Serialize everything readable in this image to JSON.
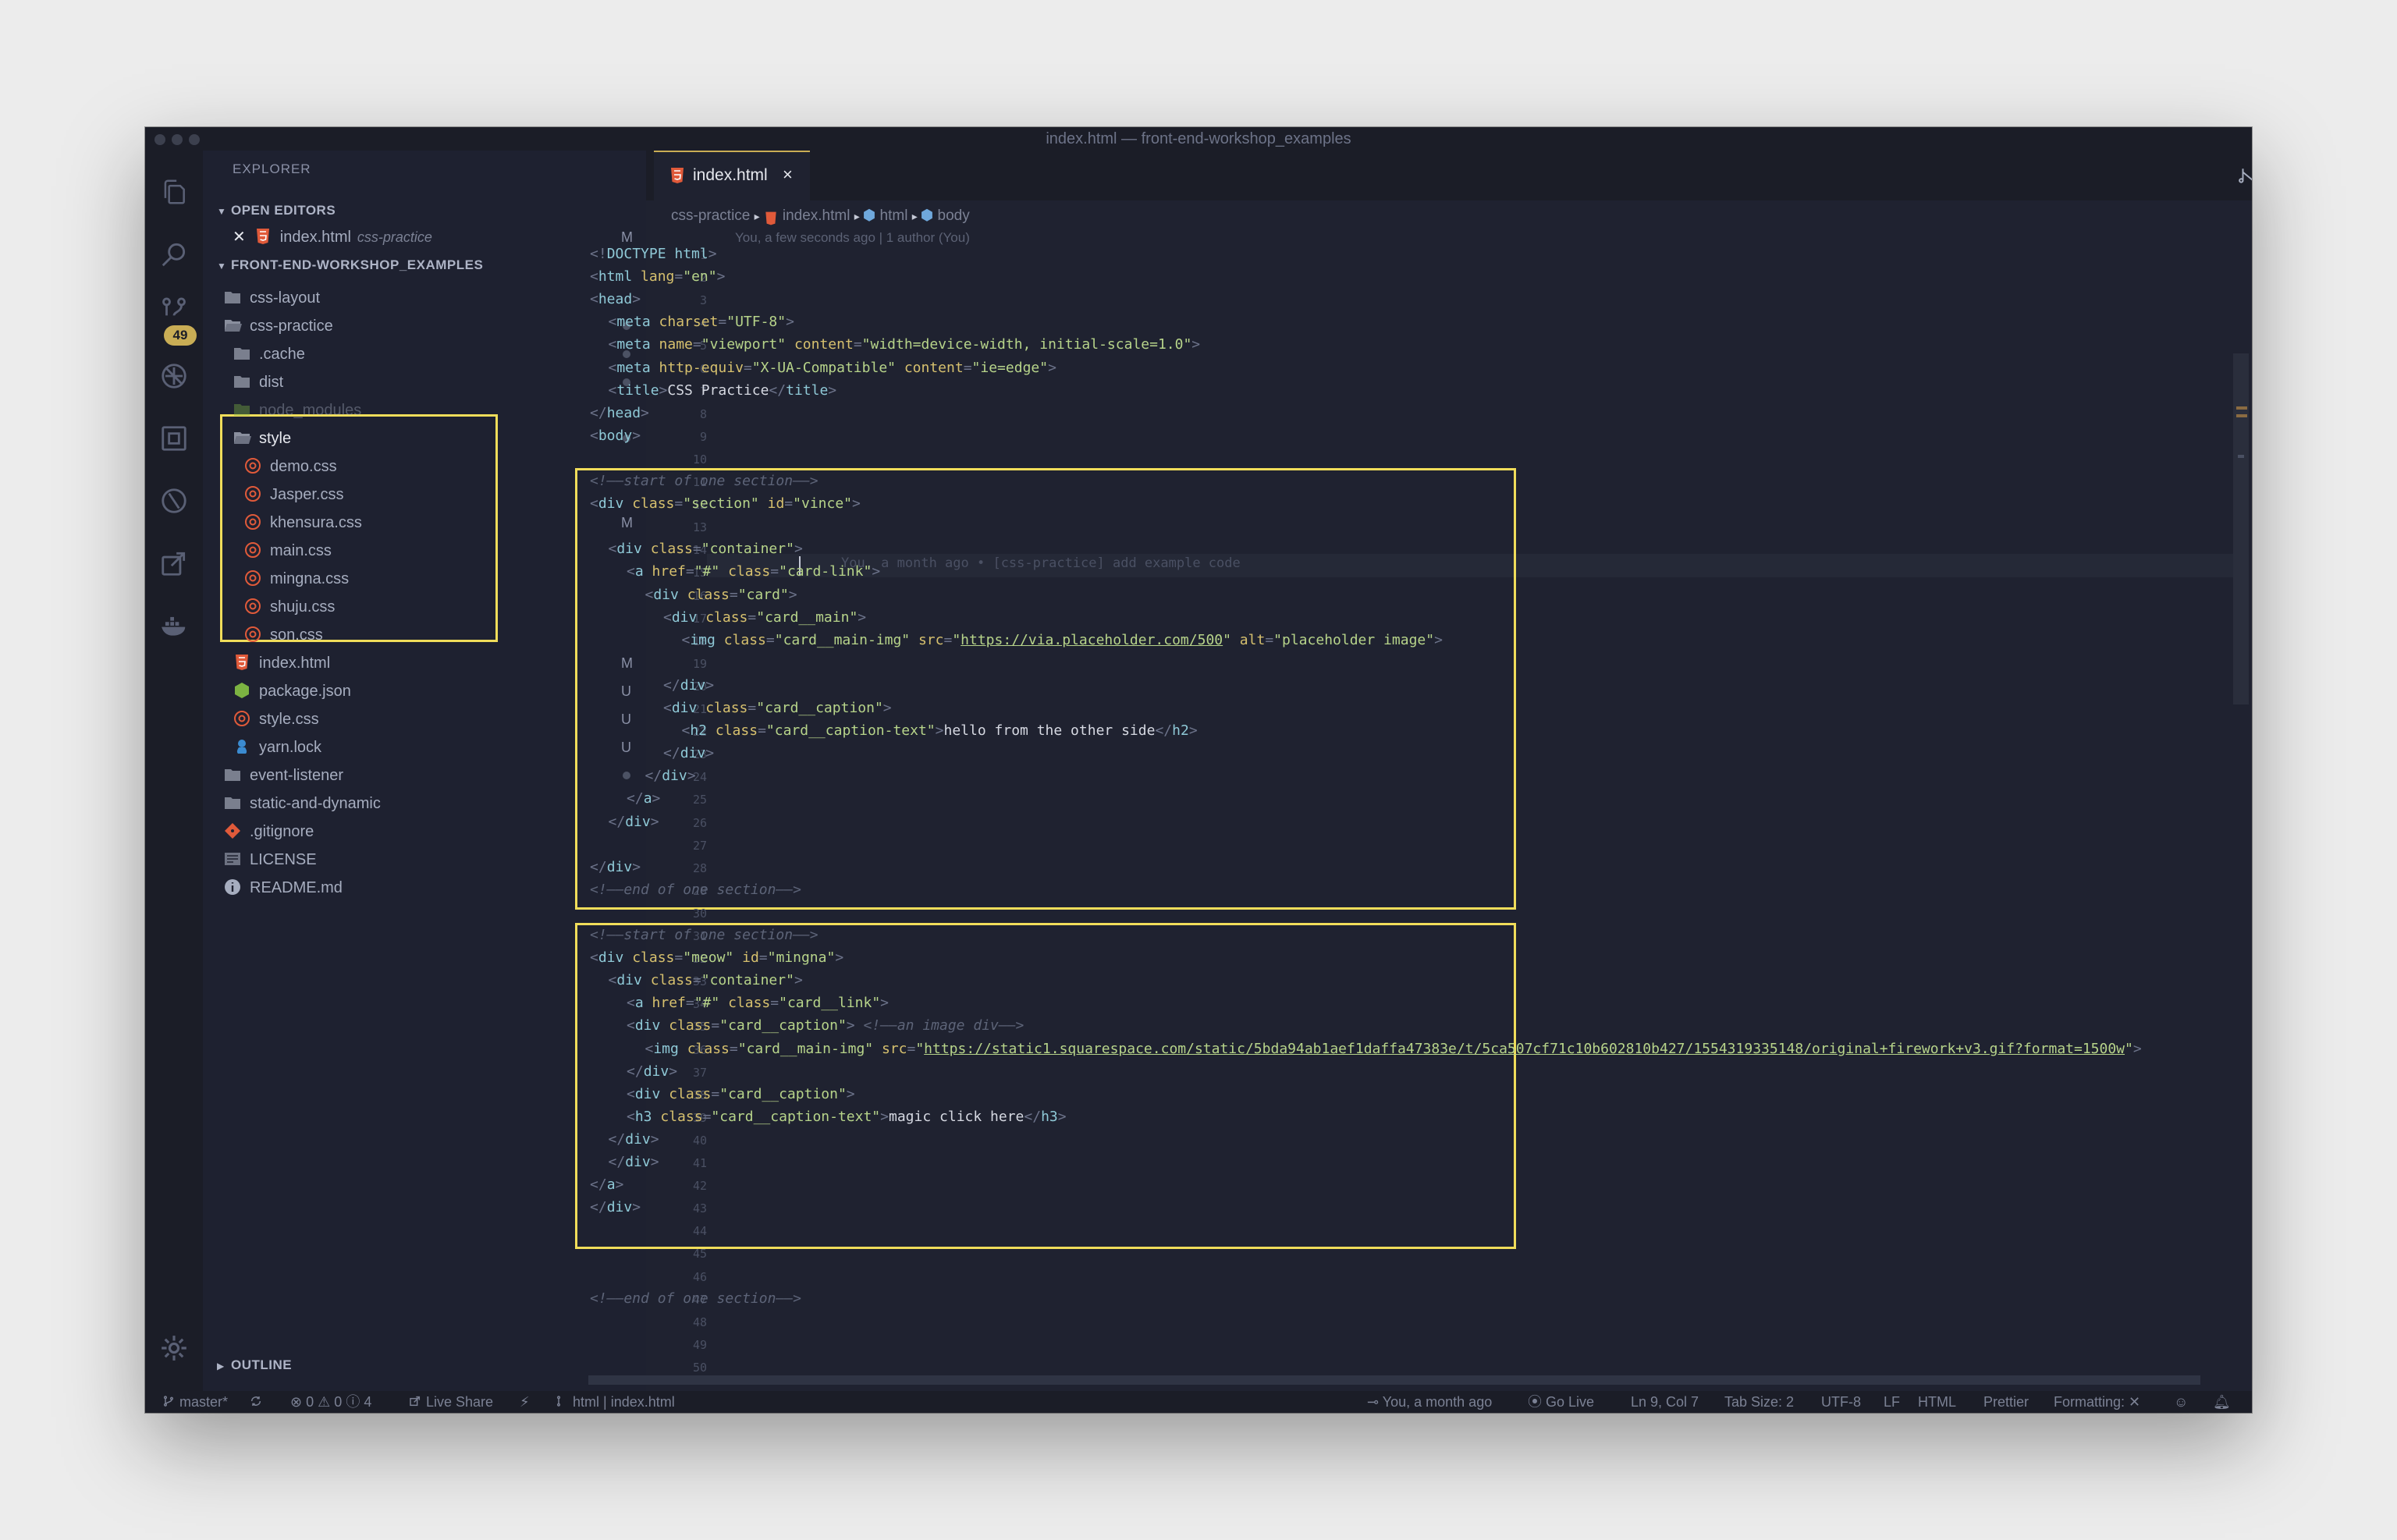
{
  "window": {
    "title": "index.html — front-end-workshop_examples"
  },
  "activity_bar": {
    "icons": [
      "files-icon",
      "search-icon",
      "source-control-icon",
      "debug-icon",
      "extensions-icon",
      "timeline-icon",
      "live-share-icon",
      "docker-icon",
      "settings-gear-icon"
    ],
    "scm_badge": "49"
  },
  "sidebar": {
    "title": "EXPLORER",
    "open_editors_label": "OPEN EDITORS",
    "open_editor": {
      "name": "index.html",
      "folder": "css-practice",
      "status": "M"
    },
    "workspace_label": "FRONT-END-WORKSHOP_EXAMPLES",
    "tree": [
      {
        "name": "css-layout",
        "kind": "folder",
        "status": ""
      },
      {
        "name": "css-practice",
        "kind": "folder-open",
        "status": ""
      },
      {
        "name": ".cache",
        "kind": "folder",
        "status": ""
      },
      {
        "name": "dist",
        "kind": "folder",
        "status": ""
      },
      {
        "name": "node_modules",
        "kind": "folder-node",
        "status": ""
      },
      {
        "name": "style",
        "kind": "folder-open",
        "status": ""
      },
      {
        "name": "demo.css",
        "kind": "css",
        "status": ""
      },
      {
        "name": "Jasper.css",
        "kind": "css",
        "status": ""
      },
      {
        "name": "khensura.css",
        "kind": "css",
        "status": "M"
      },
      {
        "name": "main.css",
        "kind": "css",
        "status": ""
      },
      {
        "name": "mingna.css",
        "kind": "css",
        "status": ""
      },
      {
        "name": "shuju.css",
        "kind": "css",
        "status": ""
      },
      {
        "name": "son.css",
        "kind": "css",
        "status": ""
      },
      {
        "name": "index.html",
        "kind": "html",
        "status": "M"
      },
      {
        "name": "package.json",
        "kind": "node",
        "status": "U"
      },
      {
        "name": "style.css",
        "kind": "css",
        "status": "U"
      },
      {
        "name": "yarn.lock",
        "kind": "yarn",
        "status": "U"
      },
      {
        "name": "event-listener",
        "kind": "folder",
        "status": ""
      },
      {
        "name": "static-and-dynamic",
        "kind": "folder",
        "status": ""
      },
      {
        "name": ".gitignore",
        "kind": "git",
        "status": ""
      },
      {
        "name": "LICENSE",
        "kind": "license",
        "status": ""
      },
      {
        "name": "README.md",
        "kind": "info",
        "status": ""
      }
    ],
    "outline_label": "OUTLINE"
  },
  "tabs": [
    {
      "label": "index.html",
      "close": "×"
    }
  ],
  "breadcrumb": {
    "folder": "css-practice",
    "file": "index.html",
    "sym1": "html",
    "sym2": "body"
  },
  "codelens": "You, a few seconds ago | 1 author (You)",
  "inline_blame": "You, a month ago • [css-practice] add example code",
  "colors": {
    "accent": "#c9ad55",
    "highlight": "#f0dd5a",
    "editor_bg": "#1f2230",
    "sidebar_bg": "#1e2130"
  },
  "code_lines": [
    {
      "n": "1",
      "indent": 0,
      "segs": [
        [
          "p",
          "<!"
        ],
        [
          "t",
          "DOCTYPE html"
        ],
        [
          "p",
          ">"
        ]
      ]
    },
    {
      "n": "2",
      "indent": 0,
      "segs": [
        [
          "p",
          "<"
        ],
        [
          "t",
          "html"
        ],
        [
          "a",
          " lang"
        ],
        [
          "p",
          "="
        ],
        [
          "s",
          "\"en\""
        ],
        [
          "p",
          ">"
        ]
      ]
    },
    {
      "n": "3",
      "indent": 0,
      "segs": [
        [
          "p",
          "<"
        ],
        [
          "t",
          "head"
        ],
        [
          "p",
          ">"
        ]
      ]
    },
    {
      "n": "4",
      "indent": 1,
      "segs": [
        [
          "p",
          "<"
        ],
        [
          "t",
          "meta"
        ],
        [
          "a",
          " charset"
        ],
        [
          "p",
          "="
        ],
        [
          "s",
          "\"UTF-8\""
        ],
        [
          "p",
          ">"
        ]
      ]
    },
    {
      "n": "5",
      "indent": 1,
      "segs": [
        [
          "p",
          "<"
        ],
        [
          "t",
          "meta"
        ],
        [
          "a",
          " name"
        ],
        [
          "p",
          "="
        ],
        [
          "s",
          "\"viewport\""
        ],
        [
          "a",
          " content"
        ],
        [
          "p",
          "="
        ],
        [
          "s",
          "\"width=device-width, initial-scale=1.0\""
        ],
        [
          "p",
          ">"
        ]
      ]
    },
    {
      "n": "6",
      "indent": 1,
      "segs": [
        [
          "p",
          "<"
        ],
        [
          "t",
          "meta"
        ],
        [
          "a",
          " http-equiv"
        ],
        [
          "p",
          "="
        ],
        [
          "s",
          "\"X-UA-Compatible\""
        ],
        [
          "a",
          " content"
        ],
        [
          "p",
          "="
        ],
        [
          "s",
          "\"ie=edge\""
        ],
        [
          "p",
          ">"
        ]
      ]
    },
    {
      "n": "7",
      "indent": 1,
      "segs": [
        [
          "p",
          "<"
        ],
        [
          "t",
          "title"
        ],
        [
          "p",
          ">"
        ],
        [
          "x",
          "CSS Practice"
        ],
        [
          "p",
          "</"
        ],
        [
          "t",
          "title"
        ],
        [
          "p",
          ">"
        ]
      ]
    },
    {
      "n": "8",
      "indent": 0,
      "segs": [
        [
          "p",
          "</"
        ],
        [
          "t",
          "head"
        ],
        [
          "p",
          ">"
        ]
      ]
    },
    {
      "n": "9",
      "indent": 0,
      "segs": [
        [
          "p",
          "<"
        ],
        [
          "t",
          "body"
        ],
        [
          "p",
          ">"
        ]
      ]
    },
    {
      "n": "10",
      "indent": 0,
      "segs": []
    },
    {
      "n": "11",
      "indent": 0,
      "segs": [
        [
          "c",
          "<!——start of one section——>"
        ]
      ]
    },
    {
      "n": "12",
      "indent": 0,
      "segs": [
        [
          "p",
          "<"
        ],
        [
          "t",
          "div"
        ],
        [
          "a",
          " class"
        ],
        [
          "p",
          "="
        ],
        [
          "s",
          "\"section\""
        ],
        [
          "a",
          " id"
        ],
        [
          "p",
          "="
        ],
        [
          "s",
          "\"vince\""
        ],
        [
          "p",
          ">"
        ]
      ]
    },
    {
      "n": "13",
      "indent": 0,
      "segs": []
    },
    {
      "n": "14",
      "indent": 1,
      "segs": [
        [
          "p",
          "<"
        ],
        [
          "t",
          "div"
        ],
        [
          "a",
          " class"
        ],
        [
          "p",
          "="
        ],
        [
          "s",
          "\"container\""
        ],
        [
          "p",
          ">"
        ]
      ]
    },
    {
      "n": "15",
      "indent": 2,
      "segs": [
        [
          "p",
          "<"
        ],
        [
          "t",
          "a"
        ],
        [
          "a",
          " href"
        ],
        [
          "p",
          "="
        ],
        [
          "s",
          "\"#\""
        ],
        [
          "a",
          " class"
        ],
        [
          "p",
          "="
        ],
        [
          "s",
          "\"card-link\""
        ],
        [
          "p",
          ">"
        ]
      ]
    },
    {
      "n": "16",
      "indent": 3,
      "segs": [
        [
          "p",
          "<"
        ],
        [
          "t",
          "div"
        ],
        [
          "a",
          " class"
        ],
        [
          "p",
          "="
        ],
        [
          "s",
          "\"card\""
        ],
        [
          "p",
          ">"
        ]
      ]
    },
    {
      "n": "17",
      "indent": 4,
      "segs": [
        [
          "p",
          "<"
        ],
        [
          "t",
          "div"
        ],
        [
          "a",
          " class"
        ],
        [
          "p",
          "="
        ],
        [
          "s",
          "\"card__main\""
        ],
        [
          "p",
          ">"
        ]
      ]
    },
    {
      "n": "18",
      "indent": 5,
      "segs": [
        [
          "p",
          "<"
        ],
        [
          "t",
          "img"
        ],
        [
          "a",
          " class"
        ],
        [
          "p",
          "="
        ],
        [
          "s",
          "\"card__main-img\""
        ],
        [
          "a",
          " src"
        ],
        [
          "p",
          "="
        ],
        [
          "s",
          "\""
        ],
        [
          "u",
          "https://via.placeholder.com/500"
        ],
        [
          "s",
          "\""
        ],
        [
          "a",
          " alt"
        ],
        [
          "p",
          "="
        ],
        [
          "s",
          "\"placeholder image\""
        ],
        [
          "p",
          ">"
        ]
      ]
    },
    {
      "n": "19",
      "indent": 0,
      "segs": []
    },
    {
      "n": "20",
      "indent": 4,
      "segs": [
        [
          "p",
          "</"
        ],
        [
          "t",
          "div"
        ],
        [
          "p",
          ">"
        ]
      ]
    },
    {
      "n": "21",
      "indent": 4,
      "segs": [
        [
          "p",
          "<"
        ],
        [
          "t",
          "div"
        ],
        [
          "a",
          " class"
        ],
        [
          "p",
          "="
        ],
        [
          "s",
          "\"card__caption\""
        ],
        [
          "p",
          ">"
        ]
      ]
    },
    {
      "n": "22",
      "indent": 5,
      "segs": [
        [
          "p",
          "<"
        ],
        [
          "t",
          "h2"
        ],
        [
          "a",
          " class"
        ],
        [
          "p",
          "="
        ],
        [
          "s",
          "\"card__caption-text\""
        ],
        [
          "p",
          ">"
        ],
        [
          "x",
          "hello from the other side"
        ],
        [
          "p",
          "</"
        ],
        [
          "t",
          "h2"
        ],
        [
          "p",
          ">"
        ]
      ]
    },
    {
      "n": "23",
      "indent": 4,
      "segs": [
        [
          "p",
          "</"
        ],
        [
          "t",
          "div"
        ],
        [
          "p",
          ">"
        ]
      ]
    },
    {
      "n": "24",
      "indent": 3,
      "segs": [
        [
          "p",
          "</"
        ],
        [
          "t",
          "div"
        ],
        [
          "p",
          ">"
        ]
      ]
    },
    {
      "n": "25",
      "indent": 2,
      "segs": [
        [
          "p",
          "</"
        ],
        [
          "t",
          "a"
        ],
        [
          "p",
          ">"
        ]
      ]
    },
    {
      "n": "26",
      "indent": 1,
      "segs": [
        [
          "p",
          "</"
        ],
        [
          "t",
          "div"
        ],
        [
          "p",
          ">"
        ]
      ]
    },
    {
      "n": "27",
      "indent": 0,
      "segs": []
    },
    {
      "n": "28",
      "indent": 0,
      "segs": [
        [
          "p",
          "</"
        ],
        [
          "t",
          "div"
        ],
        [
          "p",
          ">"
        ]
      ]
    },
    {
      "n": "29",
      "indent": 0,
      "segs": [
        [
          "c",
          "<!——end of one section——>"
        ]
      ]
    },
    {
      "n": "30",
      "indent": 0,
      "segs": []
    },
    {
      "n": "31",
      "indent": 0,
      "segs": [
        [
          "c",
          "<!——start of one section——>"
        ]
      ]
    },
    {
      "n": "32",
      "indent": 0,
      "segs": [
        [
          "p",
          "<"
        ],
        [
          "t",
          "div"
        ],
        [
          "a",
          " class"
        ],
        [
          "p",
          "="
        ],
        [
          "s",
          "\"meow\""
        ],
        [
          "a",
          " id"
        ],
        [
          "p",
          "="
        ],
        [
          "s",
          "\"mingna\""
        ],
        [
          "p",
          ">"
        ]
      ]
    },
    {
      "n": "33",
      "indent": 1,
      "segs": [
        [
          "p",
          "<"
        ],
        [
          "t",
          "div"
        ],
        [
          "a",
          " class"
        ],
        [
          "p",
          "="
        ],
        [
          "s",
          "\"container\""
        ],
        [
          "p",
          ">"
        ]
      ]
    },
    {
      "n": "34",
      "indent": 2,
      "segs": [
        [
          "p",
          "<"
        ],
        [
          "t",
          "a"
        ],
        [
          "a",
          " href"
        ],
        [
          "p",
          "="
        ],
        [
          "s",
          "\"#\""
        ],
        [
          "a",
          " class"
        ],
        [
          "p",
          "="
        ],
        [
          "s",
          "\"card__link\""
        ],
        [
          "p",
          ">"
        ]
      ]
    },
    {
      "n": "35",
      "indent": 2,
      "segs": [
        [
          "p",
          "<"
        ],
        [
          "t",
          "div"
        ],
        [
          "a",
          " class"
        ],
        [
          "p",
          "="
        ],
        [
          "s",
          "\"card__caption\""
        ],
        [
          "p",
          ">"
        ],
        [
          "c",
          " <!——an image div——>"
        ]
      ]
    },
    {
      "n": "36",
      "indent": 3,
      "segs": [
        [
          "p",
          "<"
        ],
        [
          "t",
          "img"
        ],
        [
          "a",
          " class"
        ],
        [
          "p",
          "="
        ],
        [
          "s",
          "\"card__main-img\""
        ],
        [
          "a",
          " src"
        ],
        [
          "p",
          "="
        ],
        [
          "s",
          "\""
        ],
        [
          "u",
          "https://static1.squarespace.com/static/5bda94ab1aef1daffa47383e/t/5ca507cf71c10b602810b427/1554319335148/original+firework+v3.gif?format=1500w"
        ],
        [
          "s",
          "\""
        ],
        [
          "p",
          ">"
        ]
      ]
    },
    {
      "n": "37",
      "indent": 2,
      "segs": [
        [
          "p",
          "</"
        ],
        [
          "t",
          "div"
        ],
        [
          "p",
          ">"
        ]
      ]
    },
    {
      "n": "38",
      "indent": 2,
      "segs": [
        [
          "p",
          "<"
        ],
        [
          "t",
          "div"
        ],
        [
          "a",
          " class"
        ],
        [
          "p",
          "="
        ],
        [
          "s",
          "\"card__caption\""
        ],
        [
          "p",
          ">"
        ]
      ]
    },
    {
      "n": "39",
      "indent": 2,
      "segs": [
        [
          "p",
          "<"
        ],
        [
          "t",
          "h3"
        ],
        [
          "a",
          " class"
        ],
        [
          "p",
          "="
        ],
        [
          "s",
          "\"card__caption-text\""
        ],
        [
          "p",
          ">"
        ],
        [
          "x",
          "magic click here"
        ],
        [
          "p",
          "</"
        ],
        [
          "t",
          "h3"
        ],
        [
          "p",
          ">"
        ]
      ]
    },
    {
      "n": "40",
      "indent": 1,
      "segs": [
        [
          "p",
          "</"
        ],
        [
          "t",
          "div"
        ],
        [
          "p",
          ">"
        ]
      ]
    },
    {
      "n": "41",
      "indent": 1,
      "segs": [
        [
          "p",
          "</"
        ],
        [
          "t",
          "div"
        ],
        [
          "p",
          ">"
        ]
      ]
    },
    {
      "n": "42",
      "indent": 0,
      "segs": [
        [
          "p",
          "</"
        ],
        [
          "t",
          "a"
        ],
        [
          "p",
          ">"
        ]
      ]
    },
    {
      "n": "43",
      "indent": 0,
      "segs": [
        [
          "p",
          "</"
        ],
        [
          "t",
          "div"
        ],
        [
          "p",
          ">"
        ]
      ]
    },
    {
      "n": "44",
      "indent": 0,
      "segs": []
    },
    {
      "n": "45",
      "indent": 0,
      "segs": []
    },
    {
      "n": "46",
      "indent": 0,
      "segs": []
    },
    {
      "n": "47",
      "indent": 0,
      "segs": [
        [
          "c",
          "<!——end of one section——>"
        ]
      ]
    },
    {
      "n": "48",
      "indent": 0,
      "segs": []
    },
    {
      "n": "49",
      "indent": 0,
      "segs": []
    },
    {
      "n": "50",
      "indent": 0,
      "segs": []
    }
  ],
  "statusbar": {
    "branch": "master*",
    "problems": "0",
    "warnings": "0",
    "infos": "0",
    "info_count": "4",
    "live_share": "Live Share",
    "language_path": "html",
    "file_path": "index.html",
    "blame": "You, a month ago",
    "go_live": "Go Live",
    "position": "Ln 9, Col 7",
    "tab_size": "Tab Size: 2",
    "encoding": "UTF-8",
    "eol": "LF",
    "language": "HTML",
    "formatter": "Prettier",
    "formatting": "Formatting: ✕"
  }
}
